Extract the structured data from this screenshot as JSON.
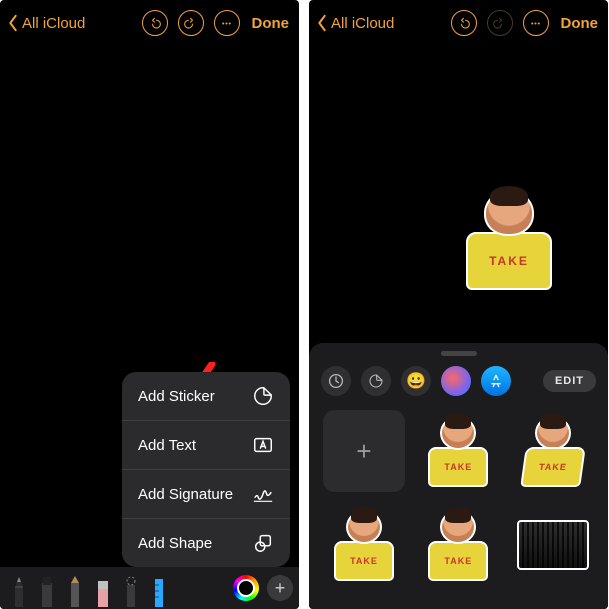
{
  "nav": {
    "back_label": "All iCloud",
    "done_label": "Done"
  },
  "popup": {
    "items": [
      {
        "label": "Add Sticker",
        "icon": "sticker-icon"
      },
      {
        "label": "Add Text",
        "icon": "textbox-icon"
      },
      {
        "label": "Add Signature",
        "icon": "signature-icon"
      },
      {
        "label": "Add Shape",
        "icon": "shapes-icon"
      }
    ]
  },
  "placed_sticker_text": "TAKE",
  "drawer": {
    "edit_label": "EDIT",
    "categories": [
      "recents",
      "sticker",
      "emoji",
      "photo",
      "appstore"
    ],
    "grid_texts": [
      "",
      "TAKE",
      "TAKE",
      "TAKE",
      "TAKE",
      ""
    ]
  }
}
